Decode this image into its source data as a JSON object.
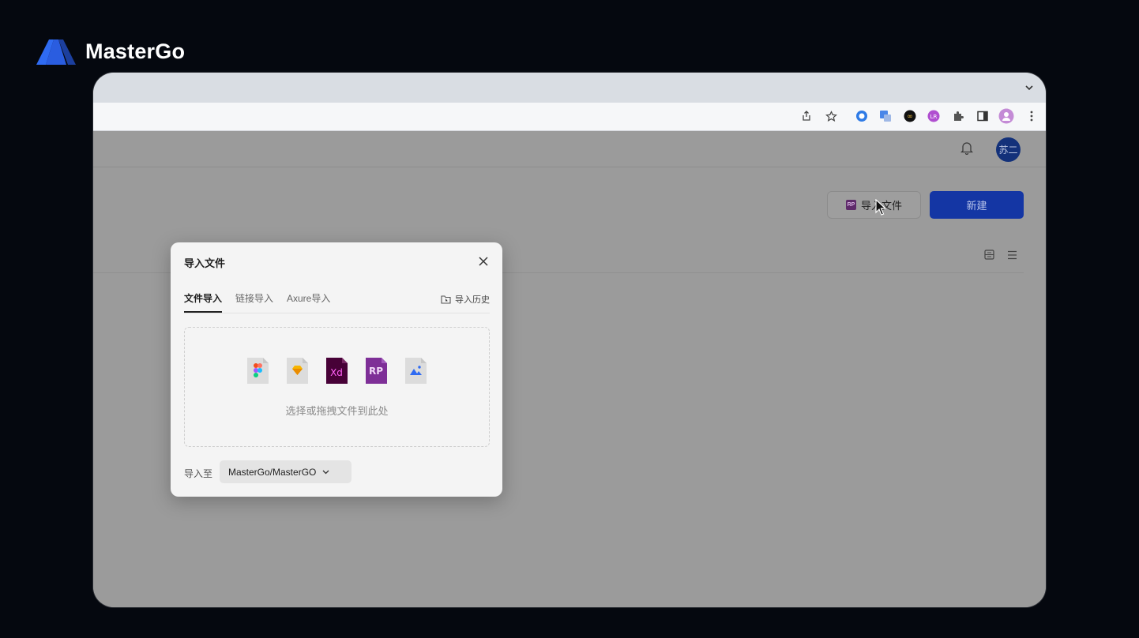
{
  "brand": {
    "name": "MasterGo"
  },
  "browser": {
    "toolbar_icons": [
      "share-icon",
      "star-icon",
      "extension-icon",
      "translate-icon",
      "infinity-extension-icon",
      "lr-extension-icon",
      "puzzle-icon",
      "sidepanel-icon",
      "profile-icon",
      "menu-icon"
    ]
  },
  "header": {
    "avatar_text": "苏二"
  },
  "actions": {
    "import_label": "导入文件",
    "import_icon_text": "RP",
    "new_label": "新建"
  },
  "dialog": {
    "title": "导入文件",
    "tabs": [
      {
        "label": "文件导入",
        "active": true
      },
      {
        "label": "链接导入",
        "active": false
      },
      {
        "label": "Axure导入",
        "active": false
      }
    ],
    "history_label": "导入历史",
    "file_types": [
      {
        "name": "figma-file-icon",
        "text": ""
      },
      {
        "name": "sketch-file-icon",
        "text": ""
      },
      {
        "name": "xd-file-icon",
        "text": "Xd"
      },
      {
        "name": "rp-file-icon",
        "text": "RP"
      },
      {
        "name": "image-file-icon",
        "text": ""
      }
    ],
    "drop_hint": "选择或拖拽文件到此处",
    "import_to_label": "导入至",
    "folder_value": "MasterGo/MasterGO"
  },
  "colors": {
    "accent": "#1436a4",
    "brand_blue": "#2f6bf2"
  }
}
